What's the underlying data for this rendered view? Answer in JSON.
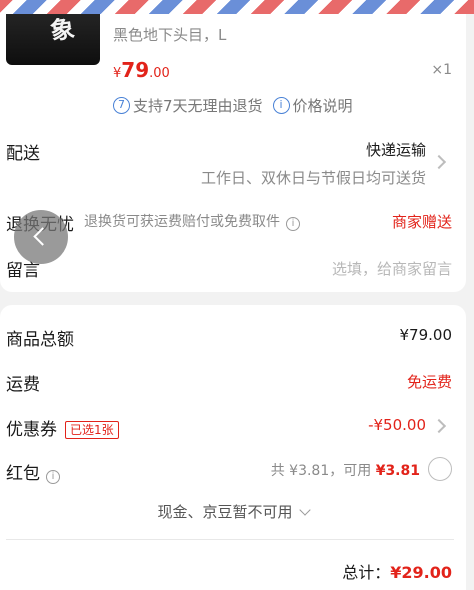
{
  "product": {
    "image": "hoodie-thumbnail",
    "variant": "黑色地下头目，L",
    "price_symbol": "¥",
    "price_int": "79",
    "price_dec": ".00",
    "quantity": "×1",
    "service_icon": "7",
    "service_text": "支持7天无理由退货",
    "price_info_icon": "i",
    "price_info_text": "价格说明"
  },
  "delivery": {
    "label": "配送",
    "method": "快递运输",
    "note": "工作日、双休日与节假日均可送货"
  },
  "worry_free": {
    "label": "退换无忧",
    "desc": "退换货可获运费赔付或免费取件",
    "value": "商家赠送"
  },
  "message": {
    "label": "留言",
    "placeholder": "选填，给商家留言"
  },
  "summary": {
    "goods_total_label": "商品总额",
    "goods_total_value": "¥79.00",
    "shipping_label": "运费",
    "shipping_value": "免运费",
    "coupon_label": "优惠券",
    "coupon_tag": "已选1张",
    "coupon_value": "-¥50.00",
    "redpacket_label": "红包",
    "redpacket_total": "共 ¥3.81，可用 ",
    "redpacket_available": "¥3.81",
    "cash_note": "现金、京豆暂不可用",
    "total_label": "总计：",
    "total_value": "¥29.00"
  },
  "colors": {
    "accent_red": "#e2231a",
    "info_blue": "#4a82d6"
  }
}
